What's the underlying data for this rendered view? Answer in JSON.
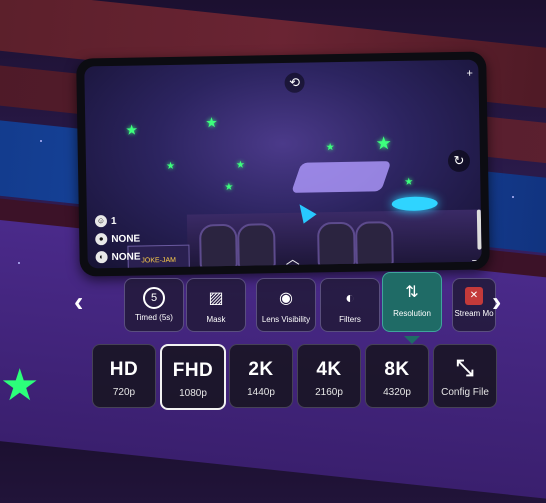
{
  "phone": {
    "hud": [
      {
        "label": "1"
      },
      {
        "label": "NONE"
      },
      {
        "label": "NONE"
      }
    ],
    "sign_text": "JOKE-JAM"
  },
  "toolbar": {
    "prev_label": "‹",
    "next_label": "›",
    "items": [
      {
        "label": "Timed (5s)",
        "icon": "timer-icon",
        "glyph": "5"
      },
      {
        "label": "Mask",
        "icon": "mask-icon",
        "glyph": "▨"
      },
      {
        "label": "Lens Visibility",
        "icon": "lens-icon",
        "glyph": "◉"
      },
      {
        "label": "Filters",
        "icon": "filters-icon",
        "glyph": "◐"
      },
      {
        "label": "Resolution",
        "icon": "resolution-icon",
        "glyph": "⇅"
      },
      {
        "label": "Stream Mo",
        "icon": "stream-icon",
        "glyph": "✕"
      }
    ]
  },
  "resolutions": [
    {
      "main": "HD",
      "sub": "720p"
    },
    {
      "main": "FHD",
      "sub": "1080p"
    },
    {
      "main": "2K",
      "sub": "1440p"
    },
    {
      "main": "4K",
      "sub": "2160p"
    },
    {
      "main": "8K",
      "sub": "4320p"
    },
    {
      "main": "",
      "sub": "Config File"
    }
  ],
  "colors": {
    "accent_teal": "#1f6b66",
    "star_green": "#2cff7a",
    "cursor_blue": "#28c8ff"
  }
}
